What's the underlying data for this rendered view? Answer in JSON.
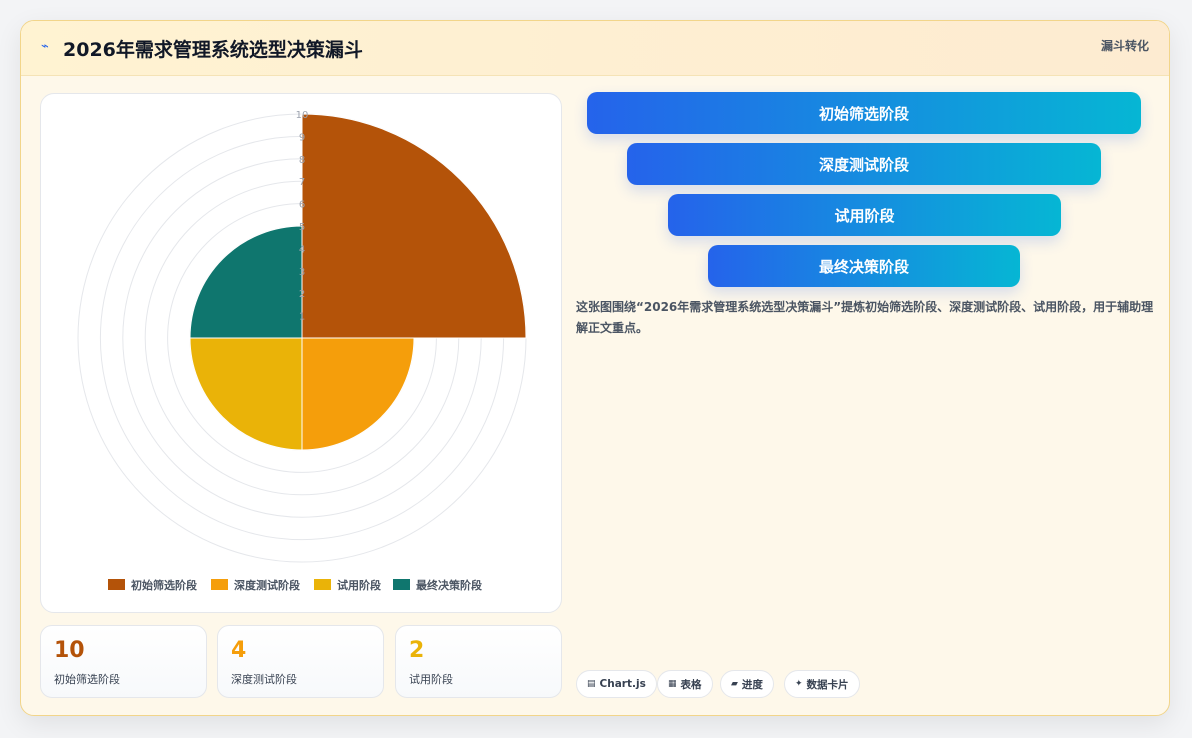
{
  "header": {
    "icon": "spark-icon",
    "title": "2026年需求管理系统选型决策漏斗",
    "tag": "漏斗转化"
  },
  "chart_data": {
    "type": "polarArea",
    "categories": [
      "初始筛选阶段",
      "深度测试阶段",
      "试用阶段",
      "最终决策阶段"
    ],
    "values": [
      10,
      5,
      5,
      5
    ],
    "colors": [
      "#b45309",
      "#f59e0b",
      "#eab308",
      "#0f766e"
    ],
    "r_range": [
      0,
      10
    ],
    "r_ticks": [
      "1",
      "2",
      "3",
      "4",
      "5",
      "6",
      "7",
      "8",
      "9",
      "10"
    ],
    "legend_position": "bottom",
    "grid": true
  },
  "stats": [
    {
      "value": "10",
      "label": "初始筛选阶段",
      "color": "#b45309"
    },
    {
      "value": "4",
      "label": "深度测试阶段",
      "color": "#f59e0b"
    },
    {
      "value": "2",
      "label": "试用阶段",
      "color": "#eab308"
    }
  ],
  "funnel": [
    {
      "label": "初始筛选阶段"
    },
    {
      "label": "深度测试阶段"
    },
    {
      "label": "试用阶段"
    },
    {
      "label": "最终决策阶段"
    }
  ],
  "description": "这张图围绕“2026年需求管理系统选型决策漏斗”提炼初始筛选阶段、深度测试阶段、试用阶段，用于辅助理解正文重点。",
  "chips": [
    {
      "icon": "chart-icon",
      "glyph": "▤",
      "label": "Chart.js"
    },
    {
      "icon": "table-icon",
      "glyph": "▦",
      "label": "表格"
    },
    {
      "icon": "progress-icon",
      "glyph": "▰",
      "label": "进度"
    },
    {
      "icon": "card-icon",
      "glyph": "✦",
      "label": "数据卡片"
    }
  ]
}
